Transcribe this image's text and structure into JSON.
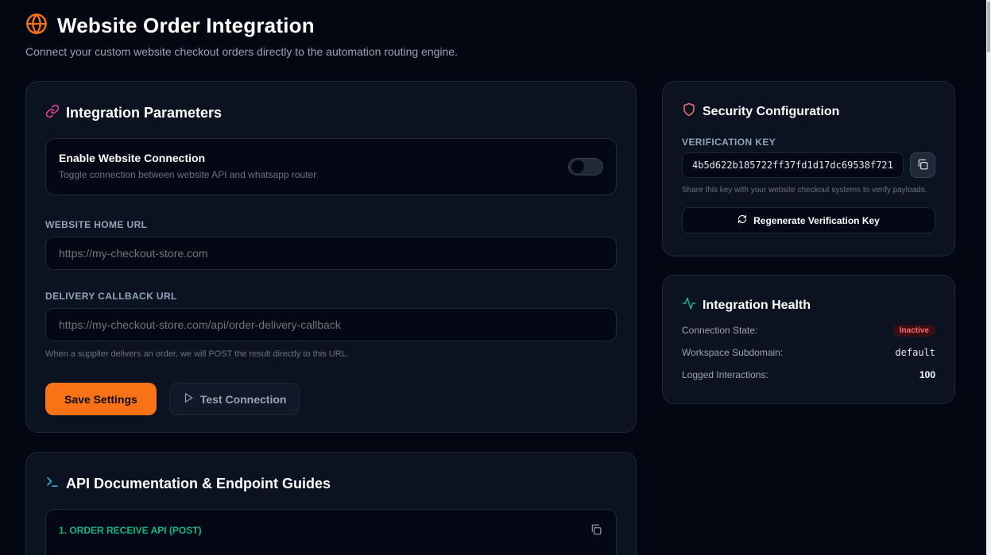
{
  "page": {
    "title": "Website Order Integration",
    "subtitle": "Connect your custom website checkout orders directly to the automation routing engine.",
    "icon": "globe-icon",
    "accent_color": "#f97316"
  },
  "params": {
    "title": "Integration Parameters",
    "icon": "link-icon",
    "toggle": {
      "title": "Enable Website Connection",
      "description": "Toggle connection between website API and whatsapp router",
      "enabled": false
    },
    "home_url": {
      "label": "WEBSITE HOME URL",
      "placeholder": "https://my-checkout-store.com"
    },
    "callback_url": {
      "label": "DELIVERY CALLBACK URL",
      "placeholder": "https://my-checkout-store.com/api/order-delivery-callback",
      "help": "When a supplier delivers an order, we will POST the result directly to this URL."
    },
    "save_label": "Save Settings",
    "test_label": "Test Connection"
  },
  "docs": {
    "title": "API Documentation & Endpoint Guides",
    "icon": "terminal-icon",
    "endpoint_1": "1. ORDER RECEIVE API (POST)"
  },
  "security": {
    "title": "Security Configuration",
    "icon": "shield-icon",
    "key_label": "VERIFICATION KEY",
    "key_value": "4b5d622b185722ff37fd1d17dc69538f721",
    "key_help": "Share this key with your website checkout systems to verify payloads.",
    "regenerate_label": "Regenerate Verification Key"
  },
  "health": {
    "title": "Integration Health",
    "icon": "activity-icon",
    "connection_state_label": "Connection State:",
    "connection_state_value": "Inactive",
    "subdomain_label": "Workspace Subdomain:",
    "subdomain_value": "default",
    "interactions_label": "Logged Interactions:",
    "interactions_value": "100"
  }
}
